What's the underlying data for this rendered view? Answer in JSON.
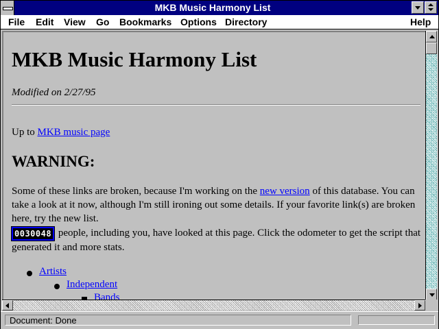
{
  "window": {
    "title": "MKB Music Harmony List"
  },
  "menu": {
    "items": [
      {
        "label": "File"
      },
      {
        "label": "Edit"
      },
      {
        "label": "View"
      },
      {
        "label": "Go"
      },
      {
        "label": "Bookmarks"
      },
      {
        "label": "Options"
      },
      {
        "label": "Directory"
      },
      {
        "label": "Help"
      }
    ]
  },
  "page": {
    "heading": "MKB Music Harmony List",
    "modified": "Modified on 2/27/95",
    "upto_prefix": "Up to ",
    "upto_link": "MKB music page",
    "warning": "WARNING:",
    "para_before_link": "Some of these links are broken, because I'm working on the ",
    "para_link": "new version",
    "para_after_link": " of this database. You can take a look at it now, although I'm still ironing out some details. If your favorite link(s) are broken here, try the new list.",
    "odometer": "0030048",
    "counter_text": " people, including you, have looked at this page. Click the odometer to get the script that generated it and more stats.",
    "list": [
      {
        "label": "Artists"
      },
      {
        "label": "Independent"
      },
      {
        "label": "Bands"
      }
    ]
  },
  "status": {
    "text": "Document: Done",
    "progress": 0
  }
}
